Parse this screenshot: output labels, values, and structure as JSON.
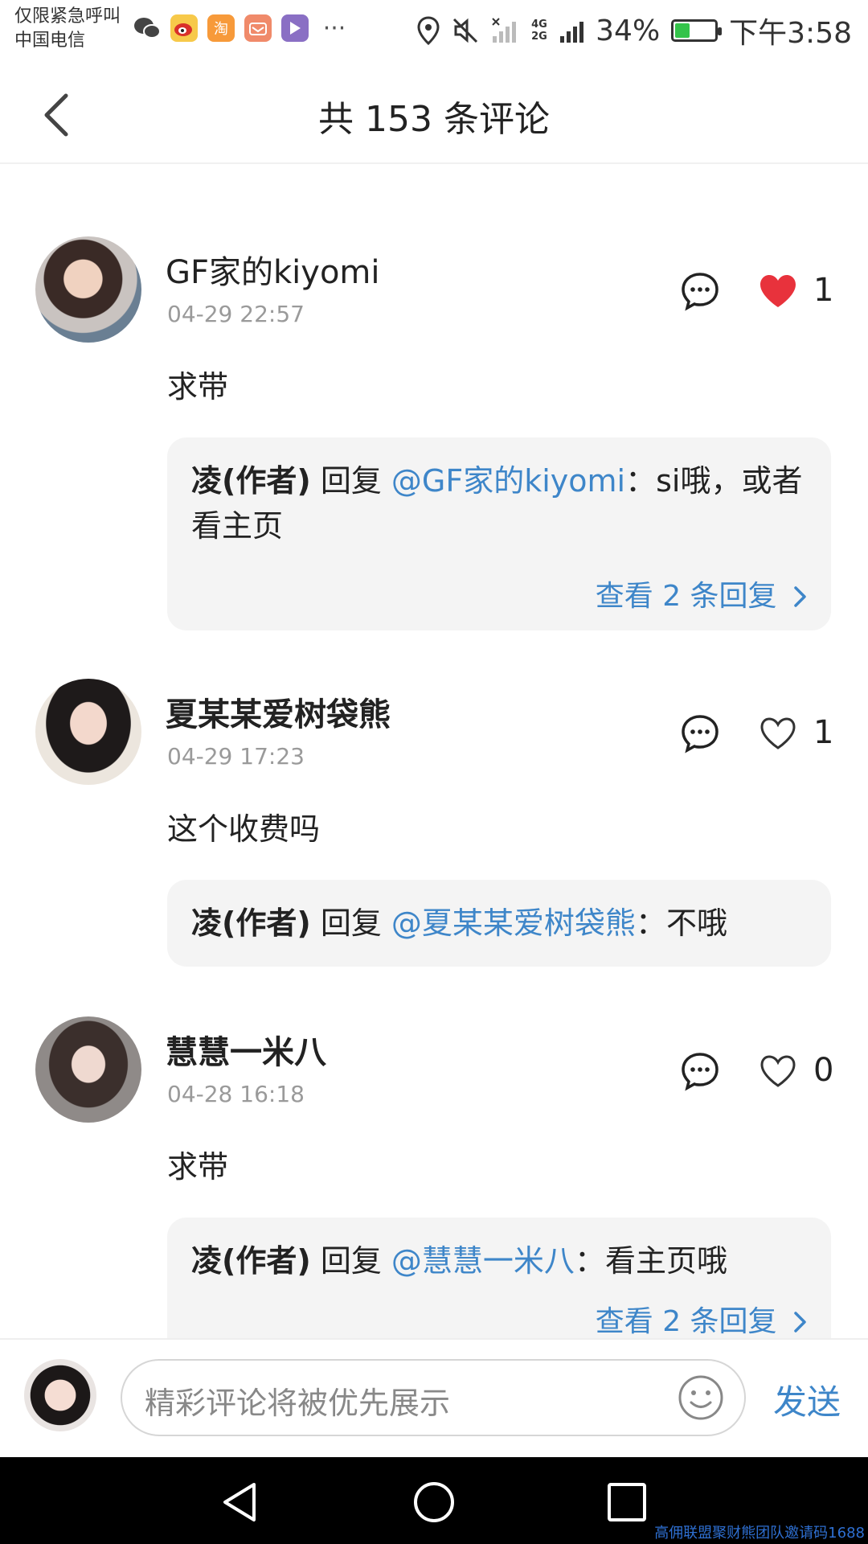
{
  "status_bar": {
    "carrier_line1": "仅限紧急呼叫",
    "carrier_line2": "中国电信",
    "notification_icons": [
      "wechat-icon",
      "weibo-icon",
      "taobao-icon",
      "mail-app-icon",
      "video-app-icon",
      "more-icon"
    ],
    "taobao_glyph": "淘",
    "more_glyph": "···",
    "network": "4G 2G",
    "battery": "34%",
    "battery_level": 0.34,
    "time": "下午3:58"
  },
  "header": {
    "title": "共 153 条评论"
  },
  "comments": [
    {
      "user": "GF家的kiyomi",
      "time": "04-29 22:57",
      "likes": "1",
      "liked": true,
      "text": "求带",
      "reply": {
        "author": "凌(作者)",
        "verb": " 回复 ",
        "mention": "@GF家的kiyomi",
        "content": "：si哦，或者看主页",
        "view_more": "查看 2 条回复"
      }
    },
    {
      "user": "夏某某爱树袋熊",
      "time": "04-29 17:23",
      "likes": "1",
      "liked": false,
      "text": "这个收费吗",
      "reply": {
        "author": "凌(作者)",
        "verb": " 回复 ",
        "mention": "@夏某某爱树袋熊",
        "content": "：不哦",
        "view_more": ""
      }
    },
    {
      "user": "慧慧一米八",
      "time": "04-28 16:18",
      "likes": "0",
      "liked": false,
      "text": "求带",
      "reply": {
        "author": "凌(作者)",
        "verb": " 回复 ",
        "mention": "@慧慧一米八",
        "content": "：看主页哦",
        "view_more": "查看 2 条回复"
      }
    }
  ],
  "input": {
    "placeholder": "精彩评论将被优先展示",
    "send_label": "发送"
  },
  "watermark": "高佣联盟聚财熊团队邀请码1688",
  "colors": {
    "accent": "#3e86c9",
    "like_red": "#e8323c",
    "reply_bg": "#f4f4f4"
  }
}
